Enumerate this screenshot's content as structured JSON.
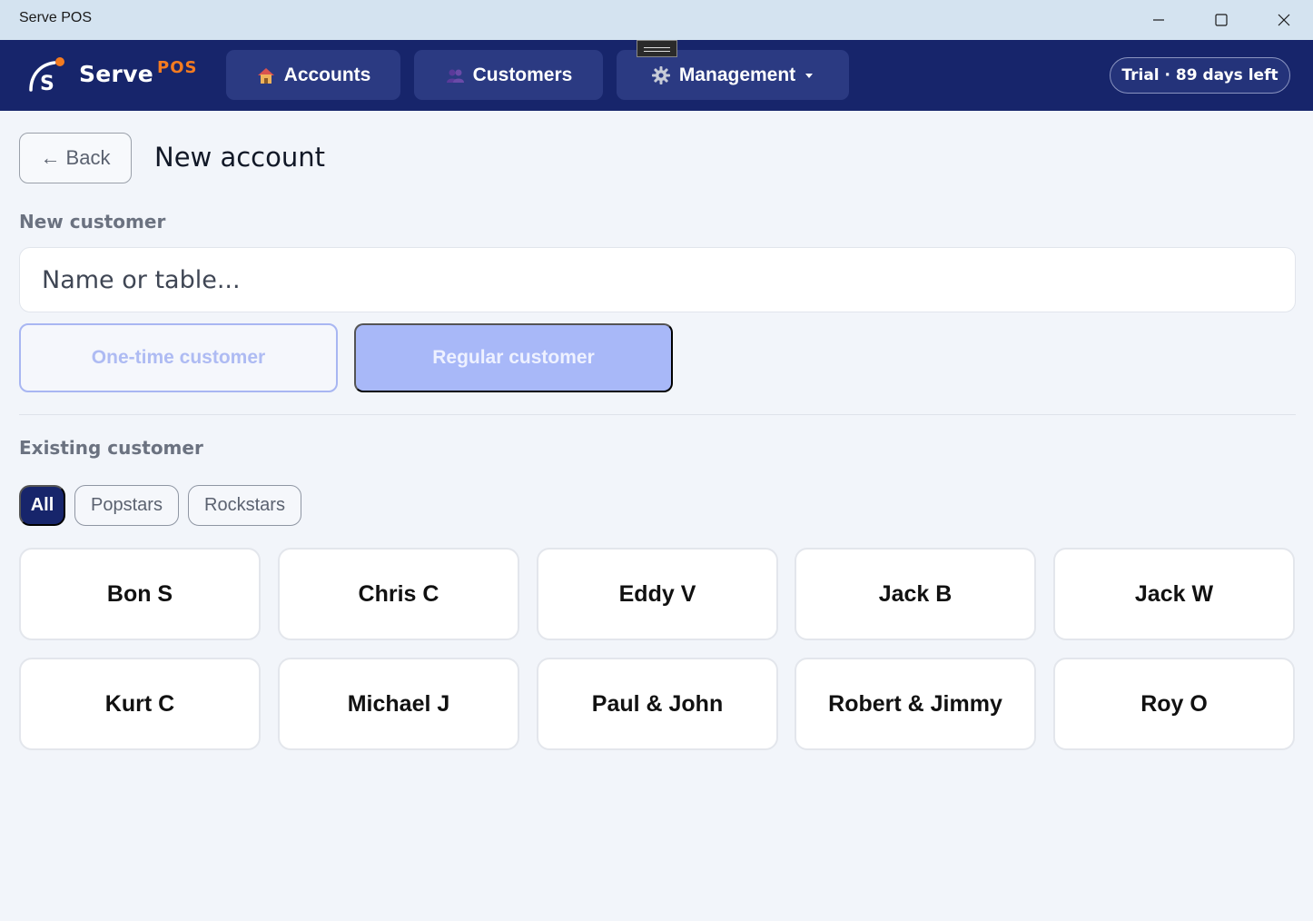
{
  "window": {
    "title": "Serve POS",
    "controls": {
      "minimize": "minimize-icon",
      "maximize": "maximize-icon",
      "close": "close-icon"
    }
  },
  "header": {
    "brand_name": "Serve",
    "brand_suffix": "POS",
    "logo_icon": "serve-logo-icon",
    "nav": [
      {
        "label": "Accounts",
        "icon": "house-icon"
      },
      {
        "label": "Customers",
        "icon": "people-icon"
      },
      {
        "label": "Management",
        "icon": "gear-icon",
        "dropdown": "caret-down-icon"
      }
    ],
    "trial_label": "Trial · 89 days left"
  },
  "page": {
    "back_label": "Back",
    "back_arrow": "←",
    "title": "New account"
  },
  "new_customer": {
    "section_label": "New customer",
    "input_placeholder": "Name or table...",
    "input_value": "",
    "one_time_label": "One-time customer",
    "regular_label": "Regular customer"
  },
  "existing_customer": {
    "section_label": "Existing customer",
    "filters": [
      {
        "label": "All",
        "selected": true
      },
      {
        "label": "Popstars",
        "selected": false
      },
      {
        "label": "Rockstars",
        "selected": false
      }
    ],
    "customers": [
      "Bon S",
      "Chris C",
      "Eddy V",
      "Jack B",
      "Jack W",
      "Kurt C",
      "Michael J",
      "Paul & John",
      "Robert & Jimmy",
      "Roy O"
    ]
  },
  "colors": {
    "header_bg": "#17256b",
    "nav_button_bg": "#2b3a82",
    "brand_accent": "#f47b20",
    "primary_soft": "#a8b8f8",
    "page_bg": "#f2f5fa",
    "titlebar_bg": "#d4e3f0"
  }
}
